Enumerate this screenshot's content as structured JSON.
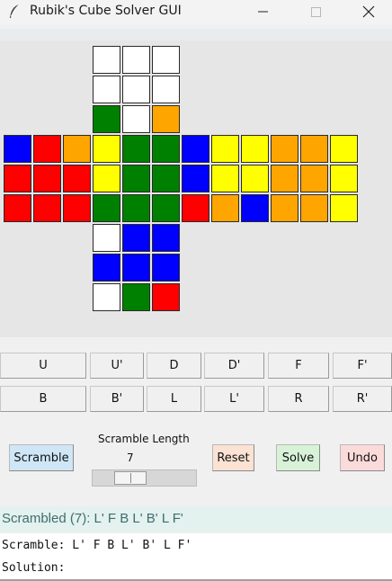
{
  "window": {
    "title": "Rubik's Cube Solver GUI",
    "icon": "feather-icon",
    "controls": [
      "minimize-icon",
      "maximize-icon",
      "close-icon"
    ]
  },
  "colors": {
    "W": "#ffffff",
    "G": "#008000",
    "O": "#ffa500",
    "B": "#0000ff",
    "R": "#ff0000",
    "Y": "#ffff00"
  },
  "cube": {
    "up": [
      [
        "W",
        "W",
        "W"
      ],
      [
        "W",
        "W",
        "W"
      ],
      [
        "G",
        "W",
        "O"
      ]
    ],
    "left": [
      [
        "B",
        "R",
        "O"
      ],
      [
        "R",
        "R",
        "R"
      ],
      [
        "R",
        "R",
        "R"
      ]
    ],
    "front": [
      [
        "Y",
        "G",
        "G"
      ],
      [
        "Y",
        "G",
        "G"
      ],
      [
        "G",
        "G",
        "G"
      ]
    ],
    "right": [
      [
        "B",
        "Y",
        "Y"
      ],
      [
        "B",
        "Y",
        "Y"
      ],
      [
        "R",
        "O",
        "B"
      ]
    ],
    "back": [
      [
        "O",
        "O",
        "Y"
      ],
      [
        "O",
        "O",
        "Y"
      ],
      [
        "O",
        "O",
        "Y"
      ]
    ],
    "down": [
      [
        "W",
        "B",
        "B"
      ],
      [
        "B",
        "B",
        "B"
      ],
      [
        "W",
        "G",
        "R"
      ]
    ]
  },
  "moves": {
    "row1": [
      "U",
      "U'",
      "D",
      "D'",
      "F",
      "F'"
    ],
    "row2": [
      "B",
      "B'",
      "L",
      "L'",
      "R",
      "R'"
    ]
  },
  "controls": {
    "scramble_label": "Scramble",
    "scramble_length_label": "Scramble Length",
    "scramble_length_value": "7",
    "scramble_length_fraction": 0.3,
    "reset_label": "Reset",
    "solve_label": "Solve",
    "undo_label": "Undo"
  },
  "status": "Scrambled (7): L' F B L' B' L F'",
  "output": {
    "scramble_line": "Scramble: L' F B L' B' L F'",
    "solution_line": "Solution:"
  }
}
